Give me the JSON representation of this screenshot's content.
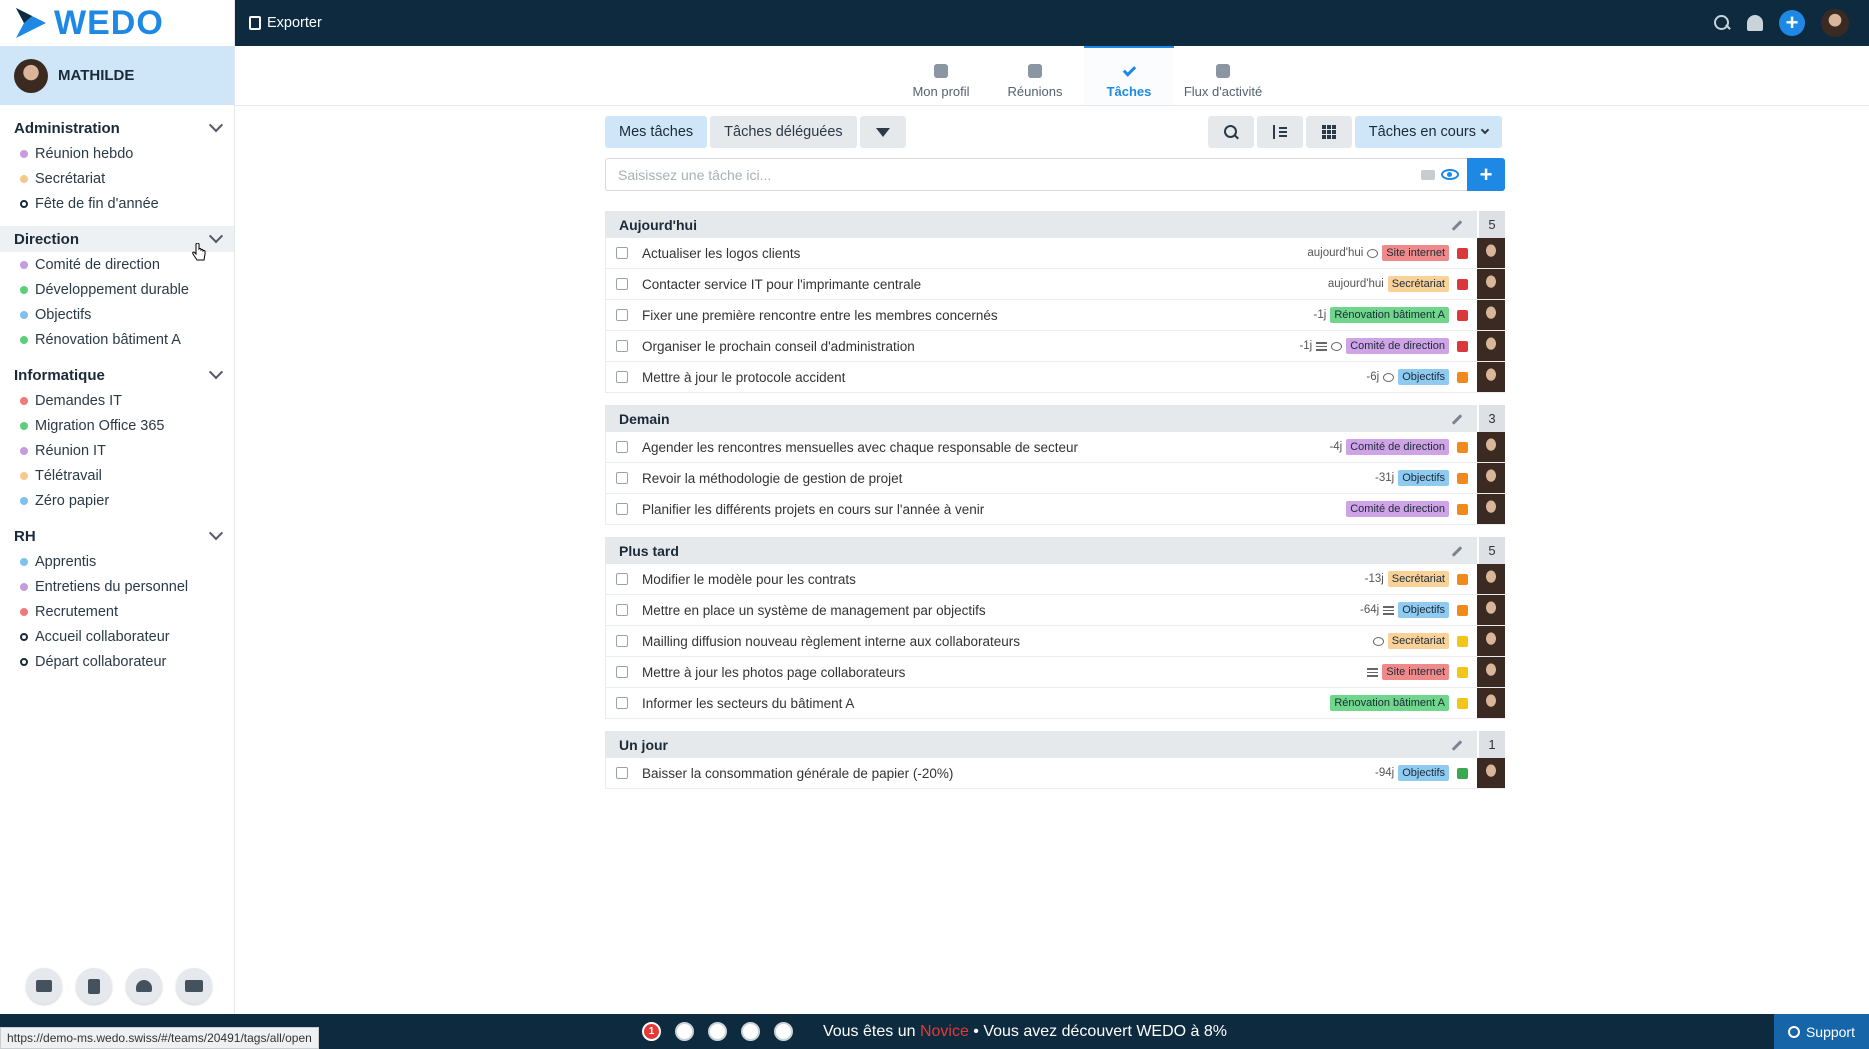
{
  "brand": {
    "logo_text": "WEDO"
  },
  "user": {
    "name": "MATHILDE"
  },
  "sidebar": {
    "groups": [
      {
        "title": "Administration",
        "items": [
          {
            "label": "Réunion hebdo",
            "color": "#c79be0",
            "type": "dot"
          },
          {
            "label": "Secrétariat",
            "color": "#f5c98a",
            "type": "dot"
          },
          {
            "label": "Fête de fin d'année",
            "color": "#1b2a38",
            "type": "check"
          }
        ]
      },
      {
        "title": "Direction",
        "items": [
          {
            "label": "Comité de direction",
            "color": "#c79be0",
            "type": "dot"
          },
          {
            "label": "Développement durable",
            "color": "#5ccf7a",
            "type": "dot"
          },
          {
            "label": "Objectifs",
            "color": "#7fc1ee",
            "type": "dot"
          },
          {
            "label": "Rénovation bâtiment A",
            "color": "#5ccf7a",
            "type": "dot"
          }
        ]
      },
      {
        "title": "Informatique",
        "items": [
          {
            "label": "Demandes IT",
            "color": "#ee7a7a",
            "type": "dot"
          },
          {
            "label": "Migration Office 365",
            "color": "#5ccf7a",
            "type": "dot"
          },
          {
            "label": "Réunion IT",
            "color": "#c79be0",
            "type": "dot"
          },
          {
            "label": "Télétravail",
            "color": "#f5c98a",
            "type": "dot"
          },
          {
            "label": "Zéro papier",
            "color": "#7fc1ee",
            "type": "dot"
          }
        ]
      },
      {
        "title": "RH",
        "items": [
          {
            "label": "Apprentis",
            "color": "#7fc1ee",
            "type": "dot"
          },
          {
            "label": "Entretiens du personnel",
            "color": "#c79be0",
            "type": "dot"
          },
          {
            "label": "Recrutement",
            "color": "#ee7a7a",
            "type": "dot"
          },
          {
            "label": "Accueil collaborateur",
            "color": "#1b2a38",
            "type": "check"
          },
          {
            "label": "Départ collaborateur",
            "color": "#1b2a38",
            "type": "check"
          }
        ]
      }
    ],
    "bottom_icons": [
      "briefcase-icon",
      "clipboard-icon",
      "team-icon",
      "org-icon"
    ]
  },
  "topbar": {
    "export_label": "Exporter"
  },
  "navtabs": [
    {
      "label": "Mon profil",
      "icon": "user-icon",
      "active": false
    },
    {
      "label": "Réunions",
      "icon": "calendar-icon",
      "active": false
    },
    {
      "label": "Tâches",
      "icon": "check-icon",
      "active": true
    },
    {
      "label": "Flux d'activité",
      "icon": "rss-icon",
      "active": false
    }
  ],
  "toolbar": {
    "my_tasks": "Mes tâches",
    "delegated": "Tâches déléguées",
    "filter_select": "Tâches en cours"
  },
  "task_input": {
    "placeholder": "Saisissez une tâche ici..."
  },
  "colors": {
    "accent": "#1e88e5",
    "nav": "#0d2a3f",
    "prio_red": "#d9393a",
    "prio_orange": "#f08a1c",
    "prio_yellow": "#f2c518",
    "prio_green": "#3aa853"
  },
  "sections": [
    {
      "title": "Aujourd'hui",
      "count": "5",
      "tasks": [
        {
          "title": "Actualiser les logos clients",
          "due": "aujourd'hui",
          "comment": true,
          "list": false,
          "tag": "Site internet",
          "tag_color": "#f08a8a",
          "prio": "#d9393a"
        },
        {
          "title": "Contacter service IT pour l'imprimante centrale",
          "due": "aujourd'hui",
          "comment": false,
          "list": false,
          "tag": "Secrétariat",
          "tag_color": "#f9d29a",
          "prio": "#d9393a"
        },
        {
          "title": "Fixer une première rencontre entre les membres concernés",
          "due": "-1j",
          "comment": false,
          "list": false,
          "tag": "Rénovation bâtiment A",
          "tag_color": "#6fd68c",
          "prio": "#d9393a"
        },
        {
          "title": "Organiser le prochain conseil d'administration",
          "due": "-1j",
          "comment": true,
          "list": true,
          "tag": "Comité de direction",
          "tag_color": "#cfa4e6",
          "prio": "#d9393a"
        },
        {
          "title": "Mettre à jour le protocole accident",
          "due": "-6j",
          "comment": true,
          "list": false,
          "tag": "Objectifs",
          "tag_color": "#8fcaf1",
          "prio": "#f08a1c"
        }
      ]
    },
    {
      "title": "Demain",
      "count": "3",
      "tasks": [
        {
          "title": "Agender les rencontres mensuelles avec chaque responsable de secteur",
          "due": "-4j",
          "comment": false,
          "list": false,
          "tag": "Comité de direction",
          "tag_color": "#cfa4e6",
          "prio": "#f08a1c"
        },
        {
          "title": "Revoir la méthodologie de gestion de projet",
          "due": "-31j",
          "comment": false,
          "list": false,
          "tag": "Objectifs",
          "tag_color": "#8fcaf1",
          "prio": "#f08a1c"
        },
        {
          "title": "Planifier les différents projets en cours sur l'année à venir",
          "due": "",
          "comment": false,
          "list": false,
          "tag": "Comité de direction",
          "tag_color": "#cfa4e6",
          "prio": "#f08a1c"
        }
      ]
    },
    {
      "title": "Plus tard",
      "count": "5",
      "tasks": [
        {
          "title": "Modifier le modèle pour les contrats",
          "due": "-13j",
          "comment": false,
          "list": false,
          "tag": "Secrétariat",
          "tag_color": "#f9d29a",
          "prio": "#f08a1c"
        },
        {
          "title": "Mettre en place un système de management par objectifs",
          "due": "-64j",
          "comment": false,
          "list": true,
          "tag": "Objectifs",
          "tag_color": "#8fcaf1",
          "prio": "#f08a1c"
        },
        {
          "title": "Mailling diffusion nouveau règlement interne aux collaborateurs",
          "due": "",
          "comment": true,
          "list": false,
          "tag": "Secrétariat",
          "tag_color": "#f9d29a",
          "prio": "#f2c518"
        },
        {
          "title": "Mettre à jour les photos page collaborateurs",
          "due": "",
          "comment": false,
          "list": true,
          "tag": "Site internet",
          "tag_color": "#f08a8a",
          "prio": "#f2c518"
        },
        {
          "title": "Informer les secteurs du bâtiment A",
          "due": "",
          "comment": false,
          "list": false,
          "tag": "Rénovation bâtiment A",
          "tag_color": "#6fd68c",
          "prio": "#f2c518"
        }
      ]
    },
    {
      "title": "Un jour",
      "count": "1",
      "tasks": [
        {
          "title": "Baisser la consommation générale de papier (-20%)",
          "due": "-94j",
          "comment": false,
          "list": false,
          "tag": "Objectifs",
          "tag_color": "#8fcaf1",
          "prio": "#3aa853"
        }
      ]
    }
  ],
  "bottombar": {
    "step_active": "1",
    "text_before": "Vous êtes un",
    "level": "Novice",
    "text_after": "• Vous avez découvert WEDO à 8%",
    "support_label": "Support",
    "status_url": "https://demo-ms.wedo.swiss/#/teams/20491/tags/all/open"
  }
}
